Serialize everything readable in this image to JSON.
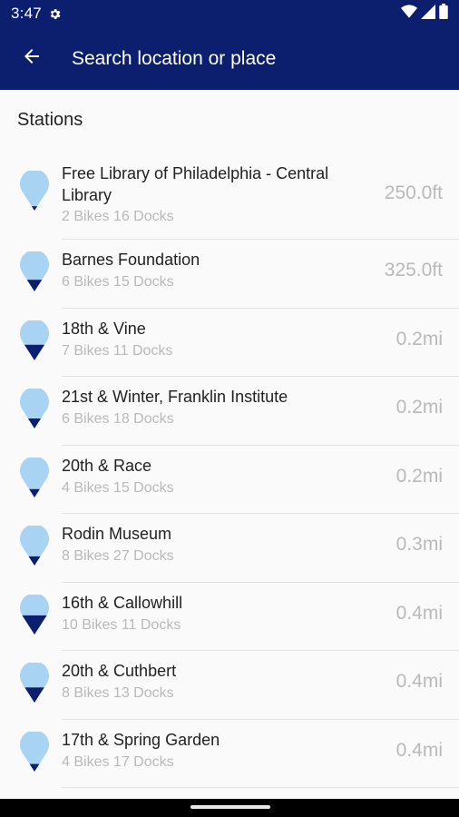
{
  "status_bar": {
    "time": "3:47",
    "icons": [
      "settings-gear-icon",
      "wifi-icon",
      "cellular-signal-icon",
      "battery-icon"
    ]
  },
  "app_bar": {
    "back_icon": "arrow-back-icon",
    "search_placeholder": "Search location or place",
    "background_color": "#0c1f6e"
  },
  "section_title": "Stations",
  "stations": [
    {
      "name": "Free Library of Philadelphia - Central Library",
      "details": "2 Bikes 16 Docks",
      "distance": "250.0ft",
      "bike_fill": 0.11
    },
    {
      "name": "Barnes Foundation",
      "details": "6 Bikes 15 Docks",
      "distance": "325.0ft",
      "bike_fill": 0.29
    },
    {
      "name": "18th & Vine",
      "details": "7 Bikes 11 Docks",
      "distance": "0.2mi",
      "bike_fill": 0.39
    },
    {
      "name": "21st & Winter, Franklin Institute",
      "details": "6 Bikes 18 Docks",
      "distance": "0.2mi",
      "bike_fill": 0.25
    },
    {
      "name": "20th & Race",
      "details": "4 Bikes 15 Docks",
      "distance": "0.2mi",
      "bike_fill": 0.21
    },
    {
      "name": "Rodin Museum",
      "details": "8 Bikes 27 Docks",
      "distance": "0.3mi",
      "bike_fill": 0.23
    },
    {
      "name": "16th & Callowhill",
      "details": "10 Bikes 11 Docks",
      "distance": "0.4mi",
      "bike_fill": 0.48
    },
    {
      "name": "20th & Cuthbert",
      "details": "8 Bikes 13 Docks",
      "distance": "0.4mi",
      "bike_fill": 0.38
    },
    {
      "name": "17th & Spring Garden",
      "details": "4 Bikes 17 Docks",
      "distance": "0.4mi",
      "bike_fill": 0.19
    }
  ],
  "colors": {
    "pin_light": "#a9d3f3",
    "pin_dark": "#0c1f6e",
    "text_secondary": "#b9b9b9"
  }
}
